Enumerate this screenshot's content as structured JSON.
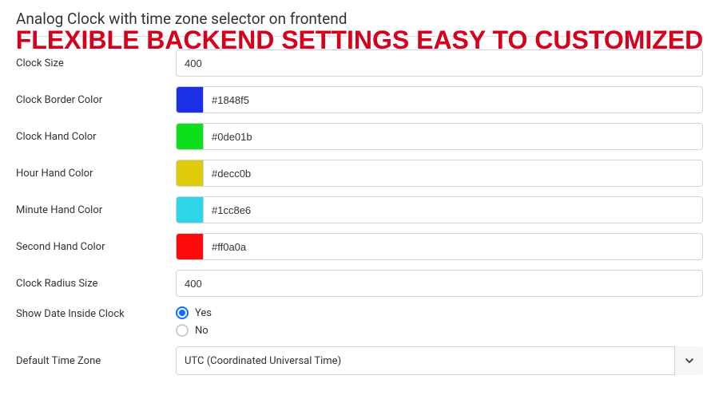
{
  "page_title": "Analog Clock with time zone selector on frontend",
  "overlay": "FLEXIBLE BACKEND SETTINGS EASY TO CUSTOMIZED",
  "fields": {
    "clock_size": {
      "label": "Clock Size",
      "value": "400"
    },
    "border_color": {
      "label": "Clock Border Color",
      "value": "#1848f5",
      "swatch": "#1b2fe6"
    },
    "hand_color": {
      "label": "Clock Hand Color",
      "value": "#0de01b",
      "swatch": "#0de01b"
    },
    "hour_hand_color": {
      "label": "Hour Hand Color",
      "value": "#decc0b",
      "swatch": "#decc0b"
    },
    "minute_hand_color": {
      "label": "Minute Hand Color",
      "value": "#1cc8e6",
      "swatch": "#2fd6e8"
    },
    "second_hand_color": {
      "label": "Second Hand Color",
      "value": "#ff0a0a",
      "swatch": "#ff0a0a"
    },
    "clock_radius": {
      "label": "Clock Radius Size",
      "value": "400"
    },
    "show_date": {
      "label": "Show Date Inside Clock",
      "options": {
        "yes": "Yes",
        "no": "No"
      },
      "selected": "yes"
    },
    "default_tz": {
      "label": "Default Time Zone",
      "value": "UTC (Coordinated Universal Time)"
    }
  }
}
